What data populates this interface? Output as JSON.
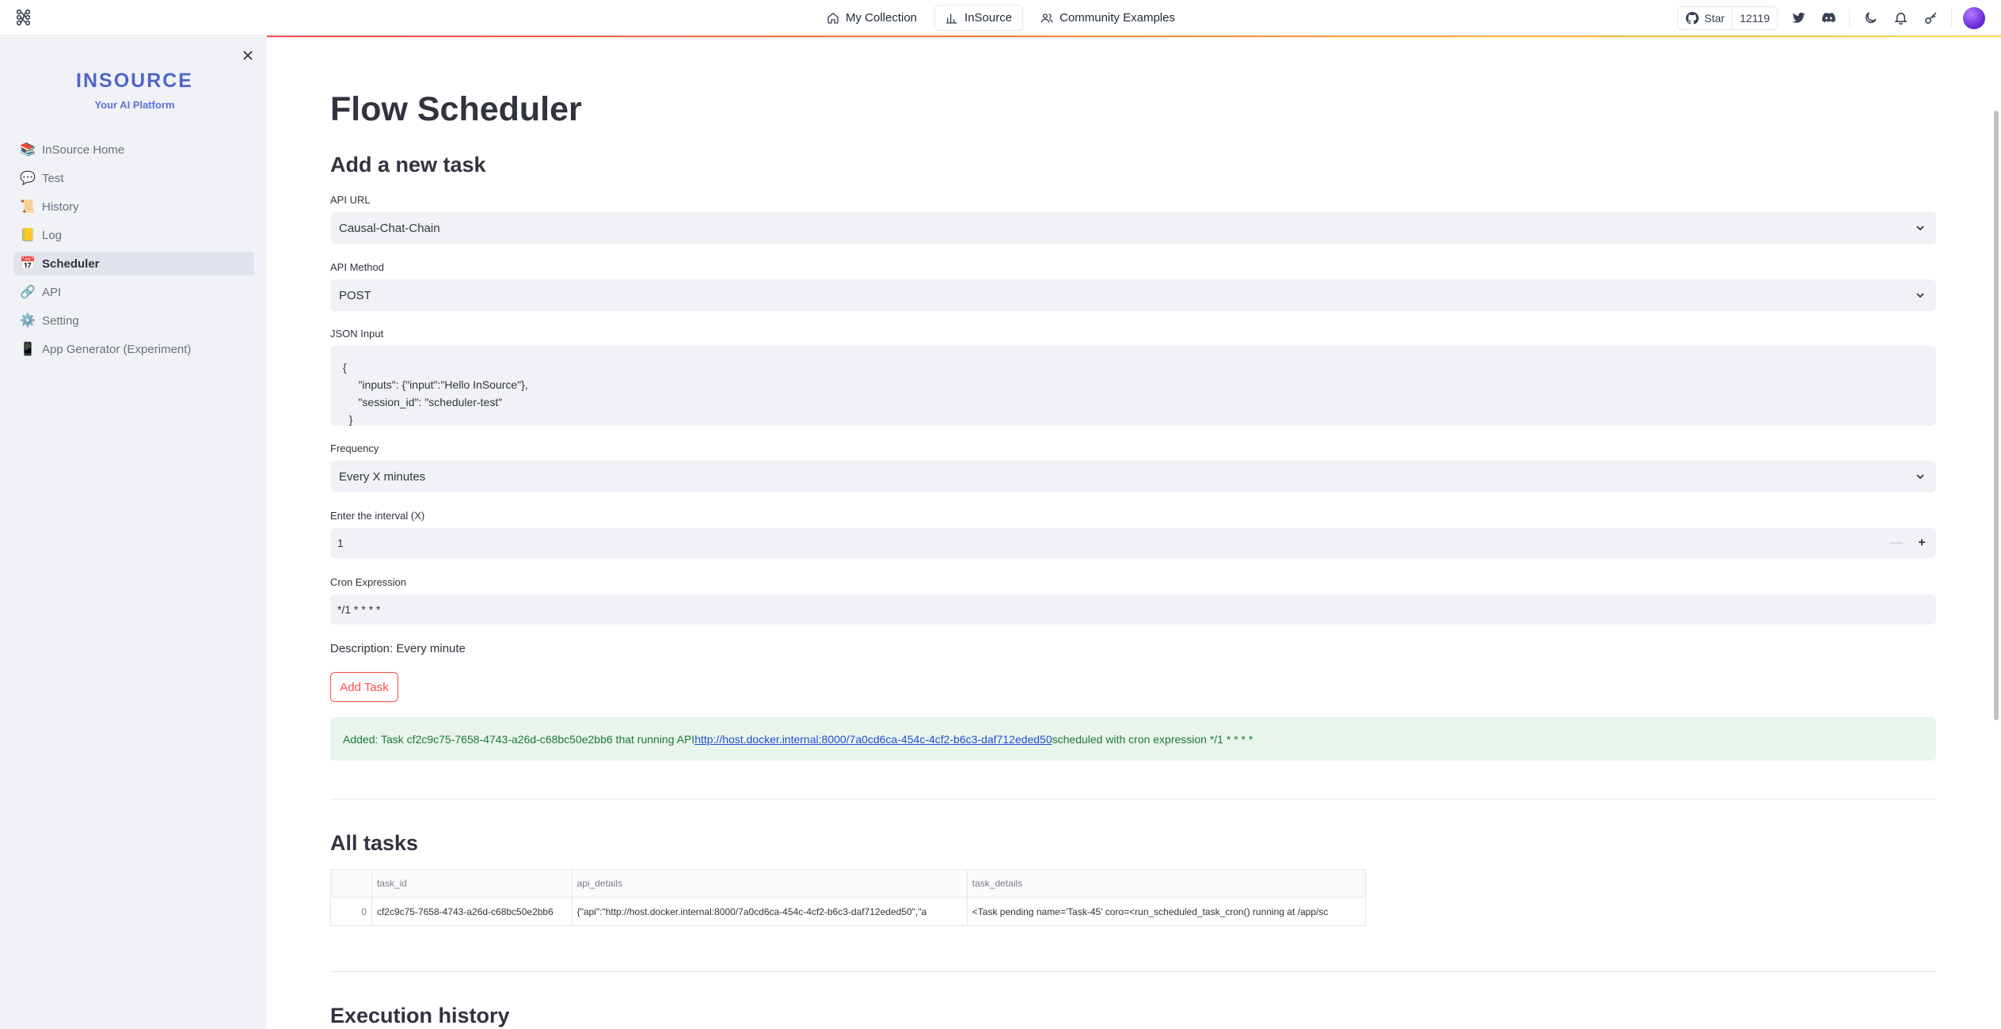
{
  "nav": {
    "items": [
      {
        "label": "My Collection",
        "icon": "home-icon"
      },
      {
        "label": "InSource",
        "icon": "bar-chart-icon"
      },
      {
        "label": "Community Examples",
        "icon": "users-icon"
      }
    ],
    "github_star_label": "Star",
    "github_star_count": "12119"
  },
  "sidebar": {
    "brand_name": "INSOURCE",
    "brand_sub": "Your AI Platform",
    "items": [
      {
        "emoji": "📚",
        "label": "InSource Home"
      },
      {
        "emoji": "💬",
        "label": "Test"
      },
      {
        "emoji": "📜",
        "label": "History"
      },
      {
        "emoji": "📒",
        "label": "Log"
      },
      {
        "emoji": "📅",
        "label": "Scheduler",
        "active": true
      },
      {
        "emoji": "🔗",
        "label": "API"
      },
      {
        "emoji": "⚙️",
        "label": "Setting"
      },
      {
        "emoji": "📱",
        "label": "App Generator (Experiment)"
      }
    ]
  },
  "page": {
    "title": "Flow Scheduler",
    "add_task_heading": "Add a new task",
    "api_url": {
      "label": "API URL",
      "value": "Causal-Chat-Chain"
    },
    "api_method": {
      "label": "API Method",
      "value": "POST"
    },
    "json_input": {
      "label": "JSON Input",
      "value": "{\n     \"inputs\": {\"input\":\"Hello InSource\"},\n     \"session_id\": \"scheduler-test\"\n  }"
    },
    "frequency": {
      "label": "Frequency",
      "value": "Every X minutes"
    },
    "interval": {
      "label": "Enter the interval (X)",
      "value": "1",
      "minus": "—",
      "plus": "+"
    },
    "cron": {
      "label": "Cron Expression",
      "value": "*/1 * * * *"
    },
    "description": "Description: Every minute",
    "add_button": "Add Task",
    "alert": {
      "prefix": "Added: Task cf2c9c75-7658-4743-a26d-c68bc50e2bb6 that running API ",
      "link": "http://host.docker.internal:8000/7a0cd6ca-454c-4cf2-b6c3-daf712eded50",
      "suffix": " scheduled with cron expression */1 * * * *"
    },
    "all_tasks_heading": "All tasks",
    "table": {
      "columns": [
        "",
        "task_id",
        "api_details",
        "task_details"
      ],
      "rows": [
        {
          "index": "0",
          "task_id": "cf2c9c75-7658-4743-a26d-c68bc50e2bb6",
          "api_details": "{\"api\":\"http://host.docker.internal:8000/7a0cd6ca-454c-4cf2-b6c3-daf712eded50\",\"a",
          "task_details": "<Task pending name='Task-45' coro=<run_scheduled_task_cron() running at /app/sc"
        }
      ]
    },
    "execution_heading": "Execution history"
  },
  "colors": {
    "accent": "#ff4b4b",
    "brand": "#4f65c9",
    "success_bg": "#e9f5eb",
    "success_text": "#1c7a34",
    "link": "#1f4dd6"
  }
}
